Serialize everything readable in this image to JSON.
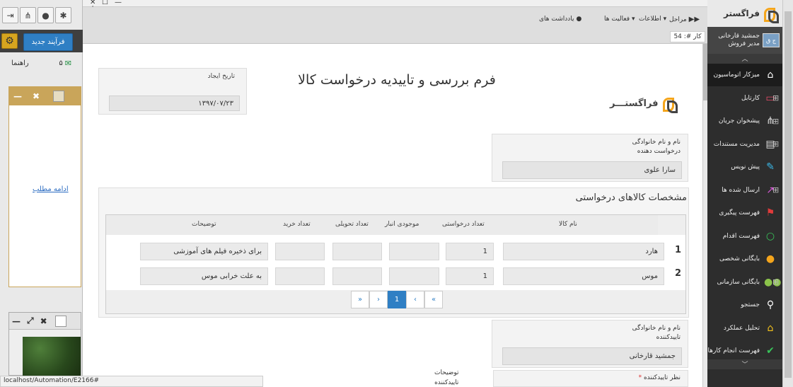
{
  "left_panel": {
    "toolbar_icons": [
      "logout-icon",
      "org-chart-icon",
      "user-icon",
      "profile-settings-icon"
    ],
    "new_process_label": "فرآیند جدید",
    "mail_count": "۵",
    "guide_label": "راهنما",
    "read_more_label": "ادامه مطلب"
  },
  "status_bar": {
    "url": "localhost/Automation/E2166#"
  },
  "toolbar": {
    "steps_label": "مراحل",
    "info_label": "اطلاعات",
    "activities_label": "فعالیت ها",
    "notes_label": "یادداشت های",
    "case_label": "کار #: 54"
  },
  "form": {
    "title": "فرم بررسی و تاییدیه درخواست کالا",
    "logo_text": "فراگستـــر",
    "date_label": "تاریخ ایجاد",
    "date_value": "۱۳۹۷/۰۷/۲۳",
    "requester_label_1": "نام و نام خانوادگی",
    "requester_label_2": "درخواست دهنده",
    "requester_value": "سارا علوی",
    "items_title": "مشخصات کالاهای درخواستی",
    "columns": {
      "name": "نام کالا",
      "requested": "تعداد درخواستی",
      "stock": "موجودی انبار",
      "delivered": "تعداد تحویلی",
      "purchased": "تعداد خرید",
      "description": "توضیحات"
    },
    "rows": [
      {
        "num": "1",
        "name": "هارد",
        "requested": "1",
        "stock": "",
        "delivered": "",
        "purchased": "",
        "description": "برای ذخیره فیلم های آموزشی"
      },
      {
        "num": "2",
        "name": "موس",
        "requested": "1",
        "stock": "",
        "delivered": "",
        "purchased": "",
        "description": "به علت خرابی موس"
      }
    ],
    "pager": {
      "first": "«",
      "prev": "‹",
      "current": "1",
      "next": "›",
      "last": "»"
    },
    "approver_label_1": "نام و نام خانوادگی",
    "approver_label_2": "تاییدکننده",
    "approver_value": "جمشید قارخانی",
    "opinion_label": "نظر تاییدکننده",
    "required_mark": "*",
    "approver_notes_1": "توضیحات",
    "approver_notes_2": "تاییدکننده"
  },
  "sidebar": {
    "brand": "فراگستر",
    "user_name": "جمشید قارخانی",
    "user_role": "مدیر فروش",
    "avatar_text": "ج ق",
    "items": [
      {
        "label": "میزکار اتوماسیون",
        "icon": "home-icon",
        "glyph": "⌂",
        "color": "#ffffff",
        "plus": false
      },
      {
        "label": "کارتابل",
        "icon": "inbox-icon",
        "glyph": "▭",
        "color": "#e84c6a",
        "plus": true
      },
      {
        "label": "پیشخوان جریان",
        "icon": "workflow-icon",
        "glyph": "⋔",
        "color": "#dddddd",
        "plus": true
      },
      {
        "label": "مدیریت مستندات",
        "icon": "document-icon",
        "glyph": "▤",
        "color": "#dddddd",
        "plus": true
      },
      {
        "label": "پیش نویس",
        "icon": "draft-icon",
        "glyph": "✎",
        "color": "#3bb8e8",
        "plus": false
      },
      {
        "label": "ارسال شده ها",
        "icon": "sent-icon",
        "glyph": "↗",
        "color": "#d85ad8",
        "plus": true
      },
      {
        "label": "فهرست پیگیری",
        "icon": "flag-icon",
        "glyph": "⚑",
        "color": "#e03b3b",
        "plus": false
      },
      {
        "label": "فهرست اقدام",
        "icon": "circle-icon",
        "glyph": "○",
        "color": "#38c45a",
        "plus": false
      },
      {
        "label": "بایگانی شخصی",
        "icon": "person-icon",
        "glyph": "●",
        "color": "#f4a51c",
        "plus": false
      },
      {
        "label": "بایگانی سازمانی",
        "icon": "group-icon",
        "glyph": "●●",
        "color": "#8bc34a",
        "plus": true
      },
      {
        "label": "جستجو",
        "icon": "search-icon",
        "glyph": "⚲",
        "color": "#ffffff",
        "plus": false
      },
      {
        "label": "تحلیل عملکرد",
        "icon": "bank-icon",
        "glyph": "⌂",
        "color": "#f4c21c",
        "plus": false
      },
      {
        "label": "فهرست انجام کارها",
        "icon": "check-icon",
        "glyph": "✔",
        "color": "#38c45a",
        "plus": false
      }
    ]
  }
}
